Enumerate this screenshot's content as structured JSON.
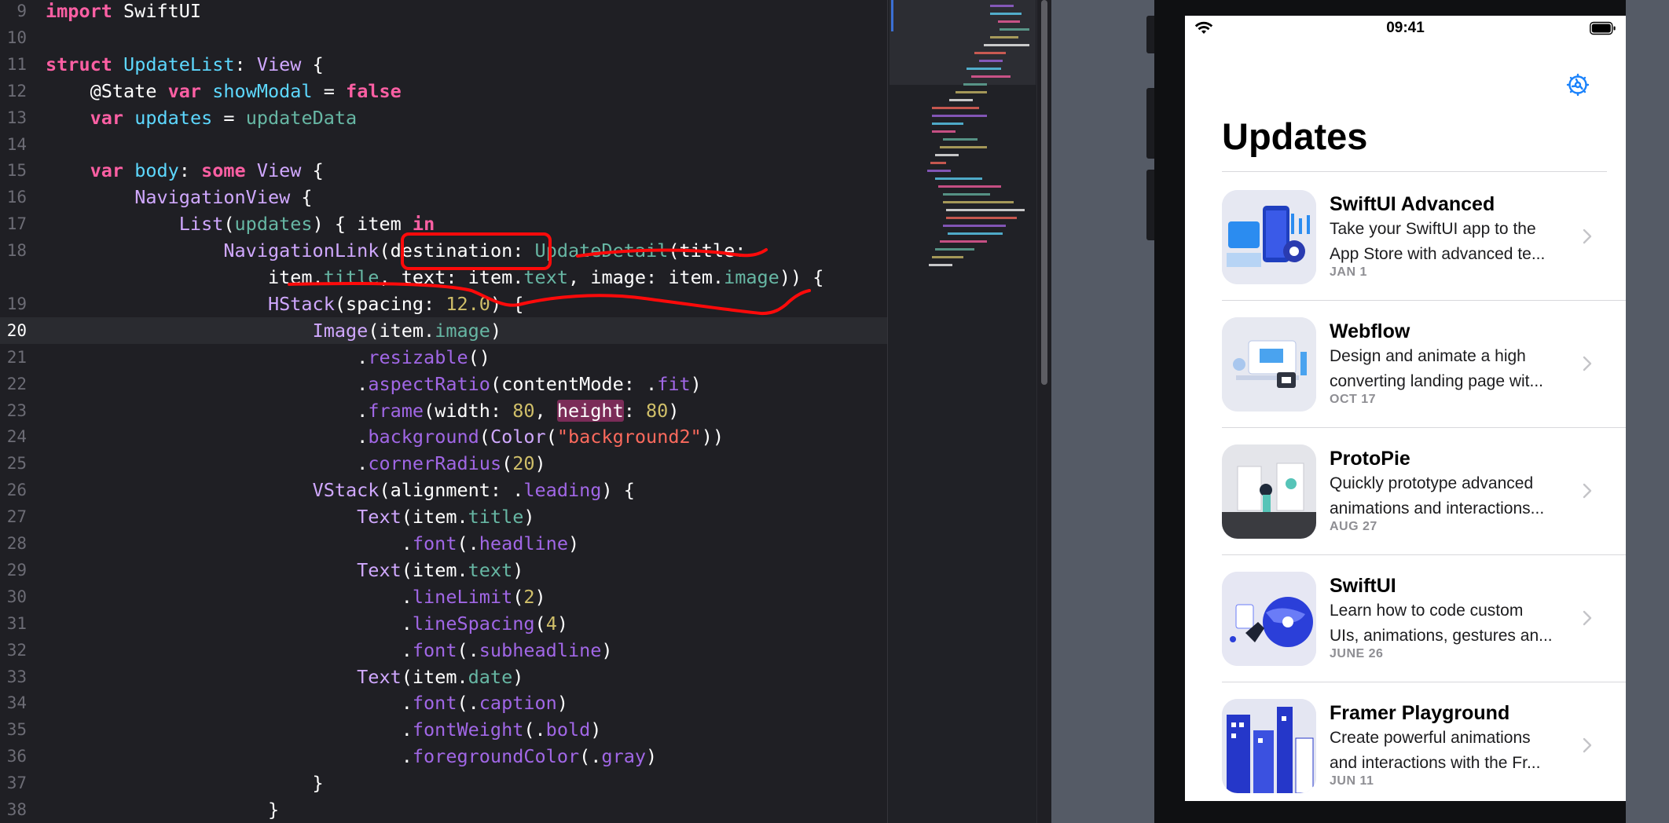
{
  "editor": {
    "current_line": "20",
    "lines": [
      {
        "n": "9",
        "code": [
          [
            "kw",
            "import"
          ],
          [
            "p",
            " SwiftUI"
          ]
        ]
      },
      {
        "n": "10",
        "code": []
      },
      {
        "n": "11",
        "code": [
          [
            "kw",
            "struct"
          ],
          [
            "p",
            " "
          ],
          [
            "ty",
            "UpdateList"
          ],
          [
            "p",
            ": "
          ],
          [
            "cl",
            "View"
          ],
          [
            "p",
            " {"
          ]
        ]
      },
      {
        "n": "12",
        "code": [
          [
            "p",
            "    @State "
          ],
          [
            "kw",
            "var"
          ],
          [
            "p",
            " "
          ],
          [
            "ty",
            "showModal"
          ],
          [
            "p",
            " = "
          ],
          [
            "kw",
            "false"
          ]
        ]
      },
      {
        "n": "13",
        "code": [
          [
            "p",
            "    "
          ],
          [
            "kw",
            "var"
          ],
          [
            "p",
            " "
          ],
          [
            "ty",
            "updates"
          ],
          [
            "p",
            " = "
          ],
          [
            "pr",
            "updateData"
          ]
        ]
      },
      {
        "n": "14",
        "code": []
      },
      {
        "n": "15",
        "code": [
          [
            "p",
            "    "
          ],
          [
            "kw",
            "var"
          ],
          [
            "p",
            " "
          ],
          [
            "ty",
            "body"
          ],
          [
            "p",
            ": "
          ],
          [
            "kw",
            "some"
          ],
          [
            "p",
            " "
          ],
          [
            "cl",
            "View"
          ],
          [
            "p",
            " {"
          ]
        ]
      },
      {
        "n": "16",
        "code": [
          [
            "p",
            "        "
          ],
          [
            "cl",
            "NavigationView"
          ],
          [
            "p",
            " {"
          ]
        ]
      },
      {
        "n": "17",
        "code": [
          [
            "p",
            "            "
          ],
          [
            "cl",
            "List"
          ],
          [
            "p",
            "("
          ],
          [
            "pr",
            "updates"
          ],
          [
            "p",
            ") { item "
          ],
          [
            "kw",
            "in"
          ]
        ]
      },
      {
        "n": "18",
        "code": [
          [
            "p",
            "                "
          ],
          [
            "cl",
            "NavigationLink"
          ],
          [
            "p",
            "("
          ],
          [
            "p",
            "destination: "
          ],
          [
            "pr",
            "UpdateDetail"
          ],
          [
            "p",
            "(title:"
          ]
        ]
      },
      {
        "n": "",
        "code": [
          [
            "p",
            "                    item."
          ],
          [
            "pr",
            "title"
          ],
          [
            "p",
            ", text: item."
          ],
          [
            "pr",
            "text"
          ],
          [
            "p",
            ", image: item."
          ],
          [
            "pr",
            "image"
          ],
          [
            "p",
            ")) {"
          ]
        ]
      },
      {
        "n": "19",
        "code": [
          [
            "p",
            "                    "
          ],
          [
            "cl",
            "HStack"
          ],
          [
            "p",
            "(spacing: "
          ],
          [
            "nu",
            "12.0"
          ],
          [
            "p",
            ") {"
          ]
        ]
      },
      {
        "n": "20",
        "code": [
          [
            "p",
            "                        "
          ],
          [
            "cl",
            "Image"
          ],
          [
            "p",
            "(item."
          ],
          [
            "pr",
            "image"
          ],
          [
            "p",
            ")"
          ]
        ]
      },
      {
        "n": "21",
        "code": [
          [
            "p",
            "                            ."
          ],
          [
            "fn",
            "resizable"
          ],
          [
            "p",
            "()"
          ]
        ]
      },
      {
        "n": "22",
        "code": [
          [
            "p",
            "                            ."
          ],
          [
            "fn",
            "aspectRatio"
          ],
          [
            "p",
            "(contentMode: ."
          ],
          [
            "fn",
            "fit"
          ],
          [
            "p",
            ")"
          ]
        ]
      },
      {
        "n": "23",
        "code": [
          [
            "p",
            "                            ."
          ],
          [
            "fn",
            "frame"
          ],
          [
            "p",
            "(width: "
          ],
          [
            "nu",
            "80"
          ],
          [
            "p",
            ", "
          ],
          [
            "hl",
            "height"
          ],
          [
            "p",
            ": "
          ],
          [
            "nu",
            "80"
          ],
          [
            "p",
            ")"
          ]
        ]
      },
      {
        "n": "24",
        "code": [
          [
            "p",
            "                            ."
          ],
          [
            "fn",
            "background"
          ],
          [
            "p",
            "("
          ],
          [
            "cl",
            "Color"
          ],
          [
            "p",
            "("
          ],
          [
            "st",
            "\"background2\""
          ],
          [
            "p",
            "))"
          ]
        ]
      },
      {
        "n": "25",
        "code": [
          [
            "p",
            "                            ."
          ],
          [
            "fn",
            "cornerRadius"
          ],
          [
            "p",
            "("
          ],
          [
            "nu",
            "20"
          ],
          [
            "p",
            ")"
          ]
        ]
      },
      {
        "n": "26",
        "code": [
          [
            "p",
            "                        "
          ],
          [
            "cl",
            "VStack"
          ],
          [
            "p",
            "(alignment: ."
          ],
          [
            "fn",
            "leading"
          ],
          [
            "p",
            ") {"
          ]
        ]
      },
      {
        "n": "27",
        "code": [
          [
            "p",
            "                            "
          ],
          [
            "cl",
            "Text"
          ],
          [
            "p",
            "(item."
          ],
          [
            "pr",
            "title"
          ],
          [
            "p",
            ")"
          ]
        ]
      },
      {
        "n": "28",
        "code": [
          [
            "p",
            "                                ."
          ],
          [
            "fn",
            "font"
          ],
          [
            "p",
            "(."
          ],
          [
            "fn",
            "headline"
          ],
          [
            "p",
            ")"
          ]
        ]
      },
      {
        "n": "29",
        "code": [
          [
            "p",
            "                            "
          ],
          [
            "cl",
            "Text"
          ],
          [
            "p",
            "(item."
          ],
          [
            "pr",
            "text"
          ],
          [
            "p",
            ")"
          ]
        ]
      },
      {
        "n": "30",
        "code": [
          [
            "p",
            "                                ."
          ],
          [
            "fn",
            "lineLimit"
          ],
          [
            "p",
            "("
          ],
          [
            "nu",
            "2"
          ],
          [
            "p",
            ")"
          ]
        ]
      },
      {
        "n": "31",
        "code": [
          [
            "p",
            "                                ."
          ],
          [
            "fn",
            "lineSpacing"
          ],
          [
            "p",
            "("
          ],
          [
            "nu",
            "4"
          ],
          [
            "p",
            ")"
          ]
        ]
      },
      {
        "n": "32",
        "code": [
          [
            "p",
            "                                ."
          ],
          [
            "fn",
            "font"
          ],
          [
            "p",
            "(."
          ],
          [
            "fn",
            "subheadline"
          ],
          [
            "p",
            ")"
          ]
        ]
      },
      {
        "n": "33",
        "code": [
          [
            "p",
            "                            "
          ],
          [
            "cl",
            "Text"
          ],
          [
            "p",
            "(item."
          ],
          [
            "pr",
            "date"
          ],
          [
            "p",
            ")"
          ]
        ]
      },
      {
        "n": "34",
        "code": [
          [
            "p",
            "                                ."
          ],
          [
            "fn",
            "font"
          ],
          [
            "p",
            "(."
          ],
          [
            "fn",
            "caption"
          ],
          [
            "p",
            ")"
          ]
        ]
      },
      {
        "n": "35",
        "code": [
          [
            "p",
            "                                ."
          ],
          [
            "fn",
            "fontWeight"
          ],
          [
            "p",
            "(."
          ],
          [
            "fn",
            "bold"
          ],
          [
            "p",
            ")"
          ]
        ]
      },
      {
        "n": "36",
        "code": [
          [
            "p",
            "                                ."
          ],
          [
            "fn",
            "foregroundColor"
          ],
          [
            "p",
            "(."
          ],
          [
            "fn",
            "gray"
          ],
          [
            "p",
            ")"
          ]
        ]
      },
      {
        "n": "37",
        "code": [
          [
            "p",
            "                        }"
          ]
        ]
      },
      {
        "n": "38",
        "code": [
          [
            "p",
            "                    }"
          ]
        ]
      }
    ]
  },
  "preview": {
    "status_time": "09:41",
    "nav_title": "Updates",
    "settings_icon": "gear-icon",
    "accent_color": "#1a82fb",
    "items": [
      {
        "title": "SwiftUI Advanced",
        "text_lines": [
          "Take your SwiftUI app to the",
          "App Store with advanced te..."
        ],
        "date": "JAN 1",
        "art": "blue"
      },
      {
        "title": "Webflow",
        "text_lines": [
          "Design and animate a high",
          "converting landing page wit..."
        ],
        "date": "OCT 17",
        "art": "light"
      },
      {
        "title": "ProtoPie",
        "text_lines": [
          "Quickly prototype advanced",
          "animations and interactions..."
        ],
        "date": "AUG 27",
        "art": "gray"
      },
      {
        "title": "SwiftUI",
        "text_lines": [
          "Learn how to code custom",
          "UIs, animations, gestures an..."
        ],
        "date": "JUNE 26",
        "art": "planet"
      },
      {
        "title": "Framer Playground",
        "text_lines": [
          "Create powerful animations",
          "and interactions with the Fr..."
        ],
        "date": "JUN 11",
        "art": "city"
      }
    ]
  }
}
